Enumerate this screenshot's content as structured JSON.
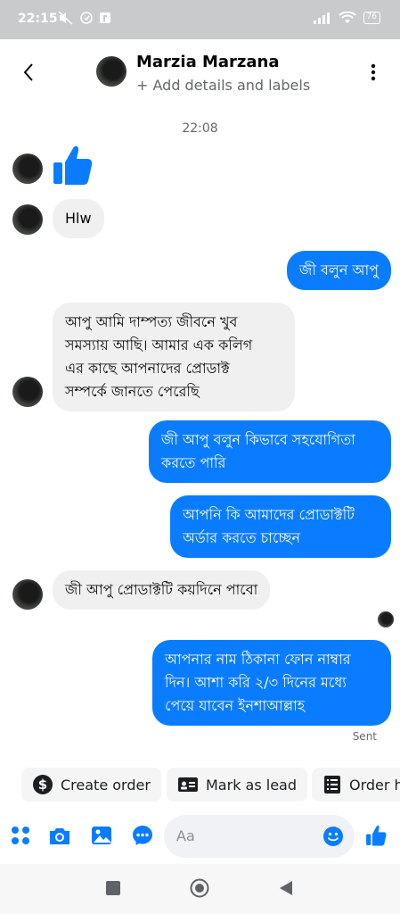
{
  "status_bar": {
    "time": "22:15",
    "battery": "76"
  },
  "header": {
    "contact_name": "Marzia Marzana",
    "subtitle": "+ Add details and labels"
  },
  "conversation": {
    "timestamp": "22:08",
    "messages": [
      {
        "from": "contact",
        "type": "like"
      },
      {
        "from": "contact",
        "text": "Hlw"
      },
      {
        "from": "me",
        "text": "জী বলুন আপু"
      },
      {
        "from": "contact",
        "lines": [
          "আপু আমি দাম্পত্য জীবনে খুব",
          "সমস্যায় আছি। আমার এক কলিগ",
          "এর কাছে আপনাদের প্রোডাক্ট",
          "সম্পর্কে জানতে পেরেছি"
        ]
      },
      {
        "from": "me",
        "lines": [
          "জী আপু বলুন কিভাবে সহযোগিতা",
          "করতে পারি"
        ]
      },
      {
        "from": "me",
        "lines": [
          "আপনি কি আমাদের প্রোডাক্টটি",
          "অর্ডার করতে চাচ্ছেন"
        ]
      },
      {
        "from": "contact",
        "text": "জী আপু প্রোডাক্টটি কয়দিনে পাবো"
      },
      {
        "from": "me",
        "lines": [
          "আপনার নাম ঠিকানা ফোন নাম্বার",
          "দিন। আশা করি ২/৩ দিনের মধ্যে",
          "পেয়ে যাবেন ইনশাআল্লাহ"
        ]
      }
    ],
    "sent_label": "Sent"
  },
  "quick_actions": {
    "create_order": "Create order",
    "mark_as_lead": "Mark as lead",
    "order_history": "Order h"
  },
  "composer": {
    "placeholder": "Aa"
  },
  "colors": {
    "accent": "#0a7cff",
    "incoming_bubble": "#f0f0f0",
    "status_bar": "#c9cacb"
  },
  "icons": [
    "back-arrow-icon",
    "more-vertical-icon",
    "menu-grid-icon",
    "camera-icon",
    "gallery-icon",
    "chat-icon",
    "emoji-icon",
    "like-icon",
    "dollar-icon",
    "id-card-icon",
    "receipt-icon"
  ]
}
